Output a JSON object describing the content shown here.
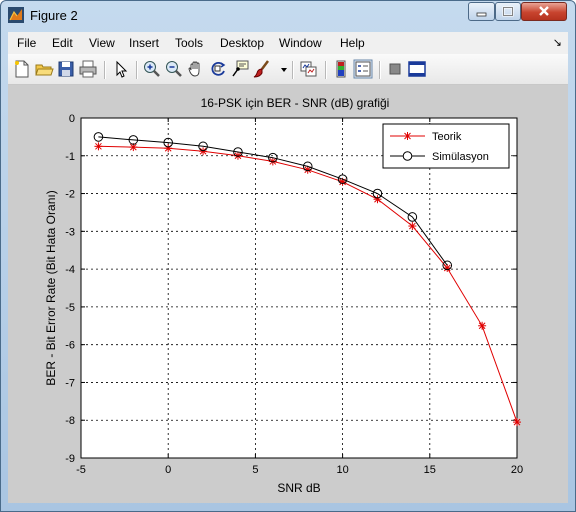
{
  "window": {
    "title": "Figure 2",
    "icons": [
      "matlab-figure-icon",
      "minimize-icon",
      "maximize-icon",
      "close-icon"
    ]
  },
  "menu": [
    "File",
    "Edit",
    "View",
    "Insert",
    "Tools",
    "Desktop",
    "Window",
    "Help"
  ],
  "toolbar": {
    "buttons": [
      "new-figure-icon",
      "open-file-icon",
      "save-icon",
      "print-icon",
      "edit-plot-arrow-icon",
      "zoom-in-icon",
      "zoom-out-icon",
      "pan-hand-icon",
      "rotate-3d-icon",
      "data-cursor-icon",
      "brush-icon",
      "link-plot-icon",
      "colorbar-icon",
      "legend-icon",
      "hide-plot-tools-icon",
      "show-plot-tools-icon"
    ]
  },
  "colors": {
    "teorik": "#e00000",
    "simulasyon": "#000000",
    "figure_bg": "#cccccc",
    "axes_bg": "#ffffff"
  },
  "chart_data": {
    "type": "line",
    "title": "16-PSK için BER - SNR (dB) grafiği",
    "xlabel": "SNR dB",
    "ylabel": "BER - Bit Error Rate (Bit Hata Oranı)",
    "xlim": [
      -5,
      20
    ],
    "ylim": [
      -9,
      0
    ],
    "xticks": [
      "-5",
      "0",
      "5",
      "10",
      "15",
      "20"
    ],
    "yticks": [
      "0",
      "-1",
      "-2",
      "-3",
      "-4",
      "-5",
      "-6",
      "-7",
      "-8",
      "-9"
    ],
    "xtick_values": [
      -5,
      0,
      5,
      10,
      15,
      20
    ],
    "ytick_values": [
      0,
      -1,
      -2,
      -3,
      -4,
      -5,
      -6,
      -7,
      -8,
      -9
    ],
    "grid": true,
    "grid_style": "dotted",
    "legend_position": "top-right",
    "series": [
      {
        "name": "Teorik",
        "color": "#e00000",
        "marker": "asterisk",
        "x": [
          -4,
          -2,
          0,
          2,
          4,
          6,
          8,
          10,
          12,
          14,
          16,
          18,
          20
        ],
        "y": [
          -0.75,
          -0.77,
          -0.8,
          -0.88,
          -1.0,
          -1.15,
          -1.37,
          -1.69,
          -2.15,
          -2.86,
          -3.97,
          -5.5,
          -8.05
        ]
      },
      {
        "name": "Simülasyon",
        "color": "#000000",
        "marker": "circle",
        "x": [
          -4,
          -2,
          0,
          2,
          4,
          6,
          8,
          10,
          12,
          14,
          16
        ],
        "y": [
          -0.5,
          -0.58,
          -0.65,
          -0.75,
          -0.9,
          -1.05,
          -1.28,
          -1.62,
          -2.0,
          -2.62,
          -3.9
        ]
      }
    ]
  }
}
